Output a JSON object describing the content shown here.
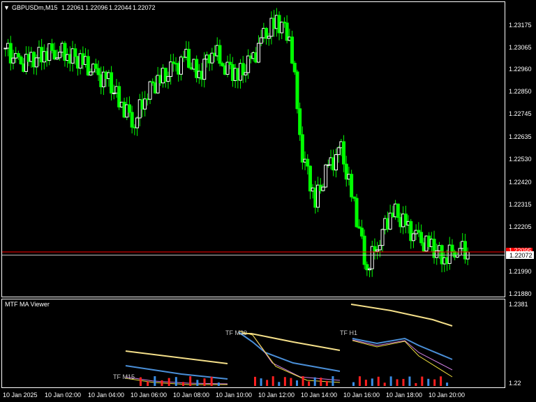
{
  "main_chart": {
    "symbol_timeframe": "GBPUSDm,M15",
    "ohlc": [
      "1.22061",
      "1.22096",
      "1.22044",
      "1.22072"
    ],
    "price_labels": [
      "1.23175",
      "1.23065",
      "1.22960",
      "1.22850",
      "1.22745",
      "1.22635",
      "1.22530",
      "1.22420",
      "1.22315",
      "1.22205",
      "1.21990",
      "1.21880"
    ],
    "current_price": "1.22072",
    "ask_label": "1.22095",
    "colors": {
      "bull": "#ffffff",
      "bear": "#00ff00",
      "wick": "#00ff00",
      "bid_line": "#c0c0c0",
      "ask_line": "#ff0000"
    }
  },
  "indicator": {
    "title": "MTF MA Viewer",
    "scale_labels": [
      "1.2381",
      "1.22"
    ],
    "tf_labels": [
      "TF M15",
      "TF M30",
      "TF H1"
    ]
  },
  "time_axis": {
    "labels": [
      "10 Jan 2025",
      "10 Jan 02:00",
      "10 Jan 04:00",
      "10 Jan 06:00",
      "10 Jan 08:00",
      "10 Jan 10:00",
      "10 Jan 12:00",
      "10 Jan 14:00",
      "10 Jan 16:00",
      "10 Jan 18:00",
      "10 Jan 20:00"
    ]
  },
  "chart_data": {
    "type": "candlestick",
    "title": "GBPUSDm,M15",
    "approx_closes": [
      1.2305,
      1.2297,
      1.2299,
      1.2303,
      1.2304,
      1.2302,
      1.2298,
      1.2292,
      1.2289,
      1.2278,
      1.227,
      1.2285,
      1.229,
      1.2295,
      1.23,
      1.2292,
      1.2305,
      1.2297,
      1.2292,
      1.2298,
      1.231,
      1.2318,
      1.2312,
      1.2255,
      1.2232,
      1.2248,
      1.2256,
      1.223,
      1.22,
      1.2215,
      1.2228,
      1.222,
      1.2213,
      1.221,
      1.2205,
      1.221,
      1.2207
    ],
    "ylim": [
      1.2188,
      1.2322
    ],
    "last": 1.22072
  }
}
